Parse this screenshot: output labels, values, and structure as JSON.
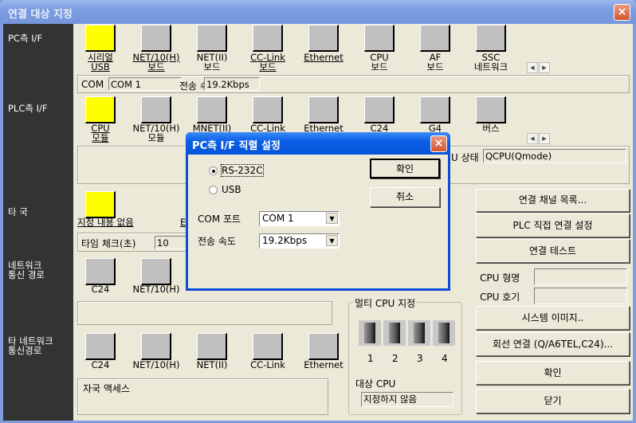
{
  "window": {
    "title": "연결 대상 지정",
    "close": "×"
  },
  "sidebar": {
    "pc_if": "PC측 I/F",
    "plc_if": "PLC측 I/F",
    "other_station": "타 국",
    "network_route": "네트워크\n통신 경로",
    "other_network_route": "타 네트워크\n통신경로"
  },
  "pc_if": {
    "items": [
      {
        "label": "시리얼\nUSB",
        "selected": true,
        "icon": "serial-usb-icon",
        "link": true
      },
      {
        "label": "NET/10(H)\n보드",
        "icon": "net10-board-icon",
        "link": true
      },
      {
        "label": "NET(II)\n보드",
        "icon": "net2-board-icon"
      },
      {
        "label": "CC-Link\n보드",
        "icon": "cclink-board-icon",
        "link": true
      },
      {
        "label": "Ethernet",
        "icon": "ethernet-board-icon",
        "link": true
      },
      {
        "label": "CPU\n보드",
        "icon": "cpu-board-icon"
      },
      {
        "label": "AF\n보드",
        "icon": "af-board-icon"
      },
      {
        "label": "SSC\n네트워크",
        "icon": "ssc-network-icon"
      }
    ],
    "com_label": "COM",
    "com_value": "COM 1",
    "speed_label": "전송 속도",
    "speed_value": "19.2Kbps"
  },
  "plc_if": {
    "items": [
      {
        "label": "CPU\n모듈",
        "selected": true,
        "icon": "cpu-module-icon",
        "link": true
      },
      {
        "label": "NET/10(H)\n모듈",
        "icon": "net10-module-icon"
      },
      {
        "label": "MNET(II)",
        "icon": "mnet-module-icon"
      },
      {
        "label": "CC-Link",
        "icon": "cclink-module-icon"
      },
      {
        "label": "Ethernet",
        "icon": "ethernet-module-icon"
      },
      {
        "label": "C24",
        "icon": "c24-module-icon"
      },
      {
        "label": "G4",
        "icon": "g4-module-icon"
      },
      {
        "label": "버스",
        "icon": "bus-icon"
      }
    ],
    "cpu_status_label": "U 상태",
    "cpu_status_value": "QCPU(Qmode)"
  },
  "other_station": {
    "label": "지정 내용 없음",
    "partial": "E",
    "time_check_label": "타임 체크(초)",
    "time_check_value": "10"
  },
  "network_route": {
    "items": [
      "C24",
      "NET/10(H)"
    ]
  },
  "other_network": {
    "items": [
      "C24",
      "NET/10(H)",
      "NET(II)",
      "CC-Link",
      "Ethernet"
    ],
    "access_label": "자국 액세스"
  },
  "multi_cpu": {
    "title": "멀티 CPU 지정",
    "cpus": [
      "1",
      "2",
      "3",
      "4"
    ],
    "target_label": "대상 CPU",
    "target_value": "지정하지 않음"
  },
  "right": {
    "channel_list": "연결 채널 목록...",
    "plc_direct": "PLC 직접 연결 설정",
    "test": "연결 테스트",
    "cpu_model_label": "CPU 형명",
    "cpu_model_value": "",
    "cpu_no_label": "CPU 호기",
    "cpu_no_value": "",
    "system_image": "시스템 이미지..",
    "line_connect": "회선 연결 (Q/A6TEL,C24)...",
    "ok": "확인",
    "close": "닫기"
  },
  "dialog": {
    "title": "PC측 I/F 직렬 설정",
    "close": "×",
    "rs232c": "RS-232C",
    "usb": "USB",
    "selected": "RS-232C",
    "com_port_label": "COM 포트",
    "com_port_value": "COM 1",
    "speed_label": "전송 속도",
    "speed_value": "19.2Kbps",
    "ok": "확인",
    "cancel": "취소"
  },
  "colors": {
    "selected_icon": "#ffff00",
    "sidebar": "#333333",
    "dialog_title": "#0a5fe6"
  }
}
